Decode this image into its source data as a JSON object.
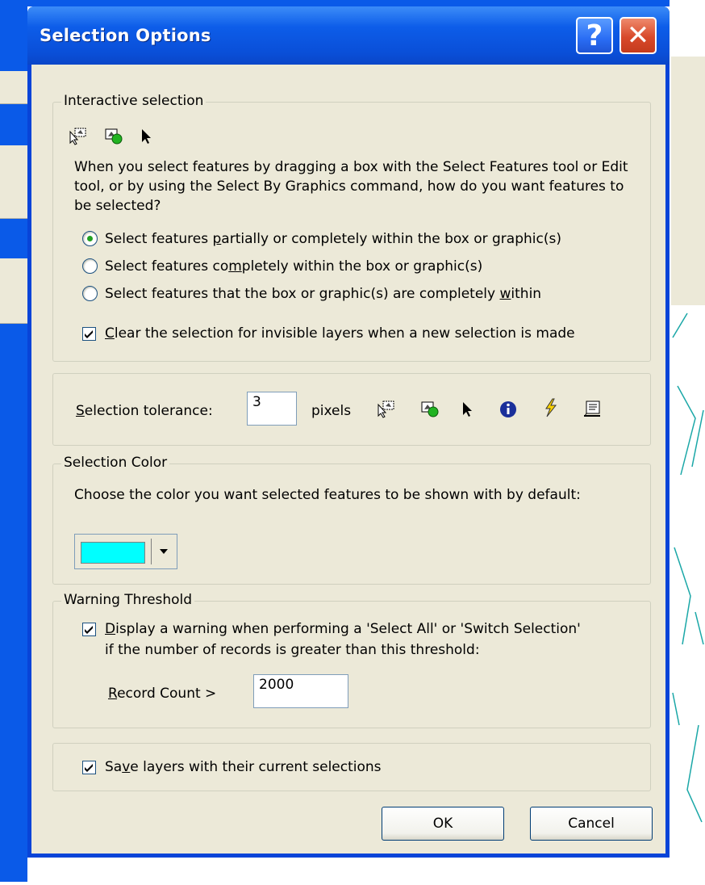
{
  "dialog": {
    "title": "Selection Options",
    "help_label": "?",
    "close_label": "✕"
  },
  "interactive": {
    "group_label": "Interactive selection",
    "description": "When you select features by dragging a box with the Select Features tool or Edit tool, or by using the Select By Graphics command, how do you want features to be selected?",
    "options": [
      {
        "pre": "Select features ",
        "u": "p",
        "post": "artially or completely within the box or graphic(s)",
        "selected": true
      },
      {
        "pre": "Select features co",
        "u": "m",
        "post": "pletely within the box or graphic(s)",
        "selected": false
      },
      {
        "pre": "Select features that the box or graphic(s) are completely ",
        "u": "w",
        "post": "ithin",
        "selected": false
      }
    ],
    "clear_u": "C",
    "clear_rest": "lear the selection for invisible layers when a new selection is made",
    "clear_checked": true
  },
  "tolerance": {
    "u": "S",
    "rest": "election tolerance:",
    "value": "3",
    "unit": "pixels"
  },
  "color": {
    "group_label": "Selection Color",
    "description": "Choose the color you want selected features to be shown with by default:",
    "swatch": "#00ffff"
  },
  "warning": {
    "group_label": "Warning Threshold",
    "display_u": "D",
    "display_line1": "isplay a warning when performing a 'Select All' or 'Switch Selection'",
    "display_line2": "if the number of records is greater than this threshold:",
    "display_checked": true,
    "record_u": "R",
    "record_rest": "ecord Count >",
    "record_value": "2000"
  },
  "save": {
    "pre": "Sa",
    "u": "v",
    "post": "e layers with their current selections",
    "checked": true
  },
  "buttons": {
    "ok": "OK",
    "cancel": "Cancel"
  },
  "colors": {
    "title_blue": "#0a5ae8",
    "face": "#ece9d8",
    "check_green": "#21a121"
  }
}
